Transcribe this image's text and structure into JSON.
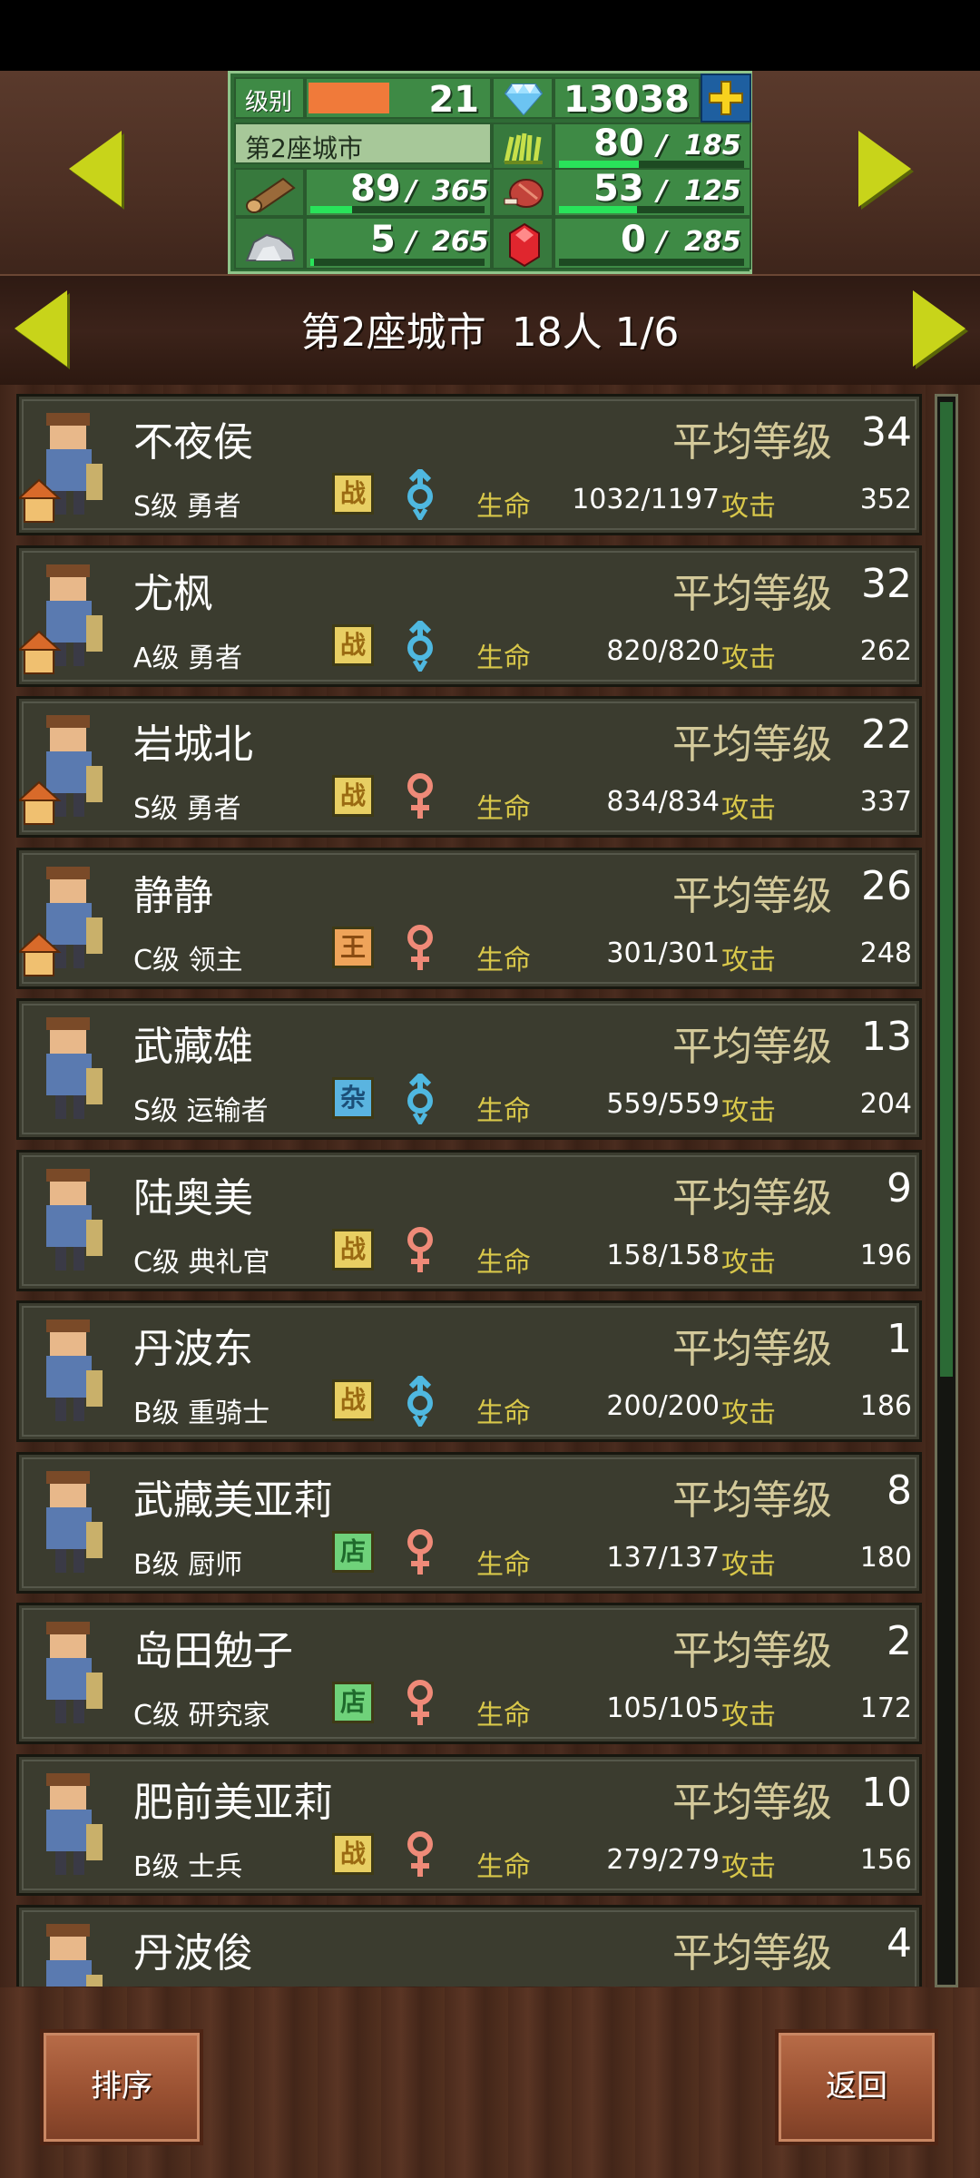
{
  "header": {
    "level_label": "级别",
    "level_value": "21",
    "level_progress": 0.45,
    "gems": "13038",
    "plus_icon": "plus-icon",
    "city_name": "第2座城市",
    "resources": {
      "food": {
        "icon": "grass-icon",
        "value": "80",
        "cap": "185",
        "fill": 0.43
      },
      "wood": {
        "icon": "log-icon",
        "value": "89",
        "cap": "365",
        "fill": 0.24
      },
      "meat": {
        "icon": "meat-icon",
        "value": "53",
        "cap": "125",
        "fill": 0.42
      },
      "stone": {
        "icon": "stone-icon",
        "value": "5",
        "cap": "265",
        "fill": 0.02
      },
      "ruby": {
        "icon": "ruby-icon",
        "value": "0",
        "cap": "285",
        "fill": 0.0
      }
    },
    "separator": "/"
  },
  "title_bar": {
    "city": "第2座城市",
    "count": "18人",
    "page": "1/6"
  },
  "row_labels": {
    "avg_level": "平均等级",
    "hp": "生命",
    "attack": "攻击"
  },
  "residents": [
    {
      "name": "不夜侯",
      "level": "34",
      "rank_job": "S级 勇者",
      "badge": "战",
      "badge_type": "zhan",
      "gender": "male",
      "hp": "1032/1197",
      "attack": "352",
      "house": true
    },
    {
      "name": "尤枫",
      "level": "32",
      "rank_job": "A级 勇者",
      "badge": "战",
      "badge_type": "zhan",
      "gender": "male",
      "hp": "820/820",
      "attack": "262",
      "house": true
    },
    {
      "name": "岩城北",
      "level": "22",
      "rank_job": "S级 勇者",
      "badge": "战",
      "badge_type": "zhan",
      "gender": "female",
      "hp": "834/834",
      "attack": "337",
      "house": true
    },
    {
      "name": "静静",
      "level": "26",
      "rank_job": "C级 领主",
      "badge": "王",
      "badge_type": "wang",
      "gender": "female",
      "hp": "301/301",
      "attack": "248",
      "house": true
    },
    {
      "name": "武藏雄",
      "level": "13",
      "rank_job": "S级 运输者",
      "badge": "杂",
      "badge_type": "za",
      "gender": "male",
      "hp": "559/559",
      "attack": "204",
      "house": false
    },
    {
      "name": "陆奥美",
      "level": "9",
      "rank_job": "C级 典礼官",
      "badge": "战",
      "badge_type": "zhan",
      "gender": "female",
      "hp": "158/158",
      "attack": "196",
      "house": false
    },
    {
      "name": "丹波东",
      "level": "1",
      "rank_job": "B级 重骑士",
      "badge": "战",
      "badge_type": "zhan",
      "gender": "male",
      "hp": "200/200",
      "attack": "186",
      "house": false
    },
    {
      "name": "武藏美亚莉",
      "level": "8",
      "rank_job": "B级 厨师",
      "badge": "店",
      "badge_type": "dian",
      "gender": "female",
      "hp": "137/137",
      "attack": "180",
      "house": false
    },
    {
      "name": "岛田勉子",
      "level": "2",
      "rank_job": "C级 研究家",
      "badge": "店",
      "badge_type": "dian",
      "gender": "female",
      "hp": "105/105",
      "attack": "172",
      "house": false
    },
    {
      "name": "肥前美亚莉",
      "level": "10",
      "rank_job": "B级 士兵",
      "badge": "战",
      "badge_type": "zhan",
      "gender": "female",
      "hp": "279/279",
      "attack": "156",
      "house": false
    },
    {
      "name": "丹波俊",
      "level": "4",
      "rank_job": "",
      "badge": "",
      "badge_type": "",
      "gender": "",
      "hp": "",
      "attack": "",
      "house": false
    }
  ],
  "footer": {
    "sort_label": "排序",
    "back_label": "返回"
  },
  "colors": {
    "accent_arrow": "#c8d41a",
    "panel_green": "#3e8a45",
    "row_bg": "#3b3c2f",
    "gold_text": "#d3c99a",
    "male": "#4fb8e0",
    "female": "#ef8a78"
  }
}
